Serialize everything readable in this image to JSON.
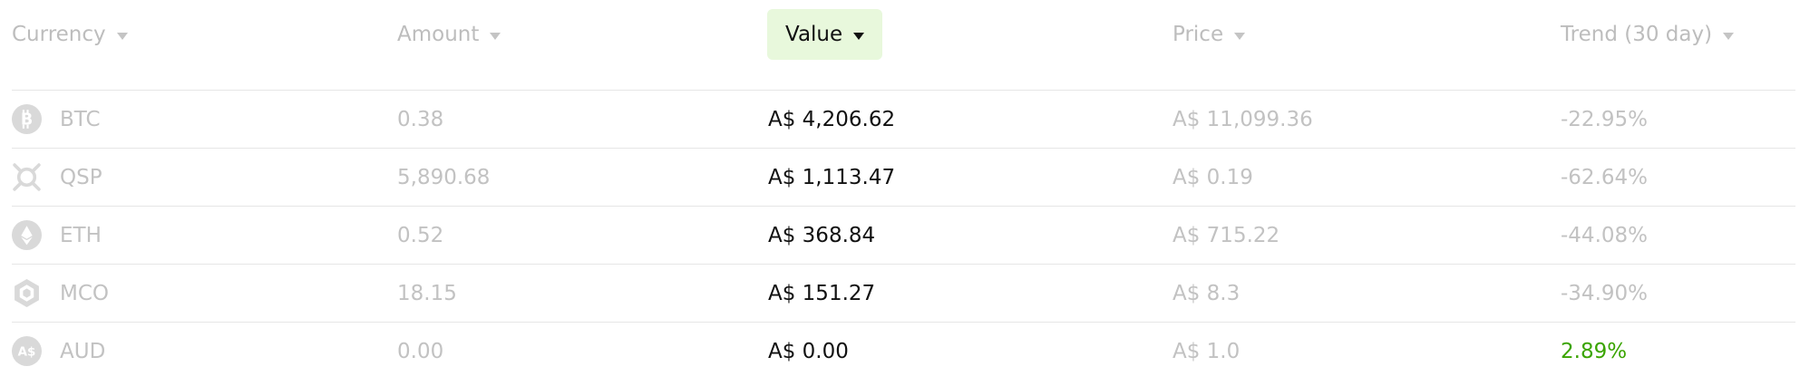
{
  "header": {
    "currency": "Currency",
    "amount": "Amount",
    "value": "Value",
    "price": "Price",
    "trend": "Trend (30 day)"
  },
  "rows": [
    {
      "icon": "btc-icon",
      "currency": "BTC",
      "amount": "0.38",
      "value": "A$ 4,206.62",
      "price": "A$ 11,099.36",
      "trend": "-22.95%",
      "trend_positive": false
    },
    {
      "icon": "qsp-icon",
      "currency": "QSP",
      "amount": "5,890.68",
      "value": "A$ 1,113.47",
      "price": "A$ 0.19",
      "trend": "-62.64%",
      "trend_positive": false
    },
    {
      "icon": "eth-icon",
      "currency": "ETH",
      "amount": "0.52",
      "value": "A$ 368.84",
      "price": "A$ 715.22",
      "trend": "-44.08%",
      "trend_positive": false
    },
    {
      "icon": "mco-icon",
      "currency": "MCO",
      "amount": "18.15",
      "value": "A$ 151.27",
      "price": "A$ 8.3",
      "trend": "-34.90%",
      "trend_positive": false
    },
    {
      "icon": "aud-icon",
      "currency": "AUD",
      "amount": "0.00",
      "value": "A$ 0.00",
      "price": "A$ 1.0",
      "trend": "2.89%",
      "trend_positive": true
    }
  ],
  "colors": {
    "active_header_bg": "#e8f8dc",
    "muted_text": "#c2c2c2",
    "primary_text": "#111111",
    "positive_trend": "#3aa400"
  }
}
